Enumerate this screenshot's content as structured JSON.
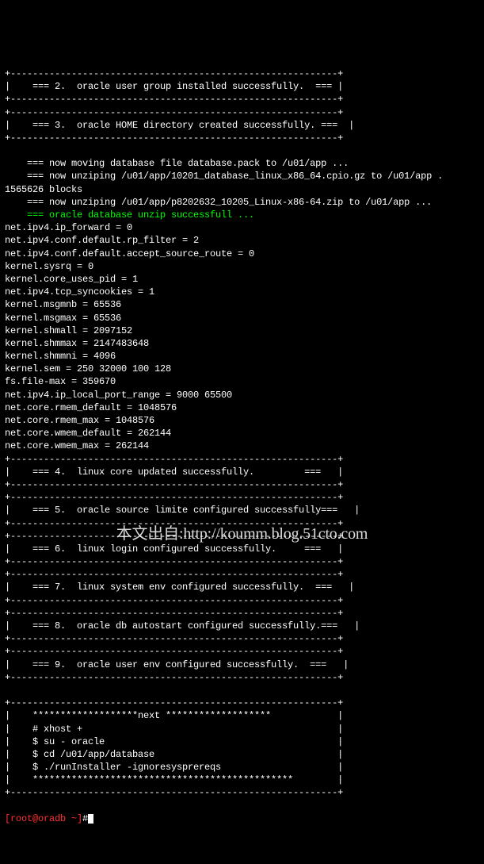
{
  "lines": [
    {
      "t": "+-----------------------------------------------------------+",
      "c": "term-line"
    },
    {
      "t": "|    === 2.  oracle user group installed successfully.  === |",
      "c": "term-line"
    },
    {
      "t": "+-----------------------------------------------------------+",
      "c": "term-line"
    },
    {
      "t": "+-----------------------------------------------------------+",
      "c": "term-line"
    },
    {
      "t": "|    === 3.  oracle HOME directory created successfully. ===  |",
      "c": "term-line"
    },
    {
      "t": "+-----------------------------------------------------------+",
      "c": "term-line"
    },
    {
      "t": "",
      "c": "term-line"
    },
    {
      "t": "    === now moving database file database.pack to /u01/app ...",
      "c": "term-line"
    },
    {
      "t": "    === now unziping /u01/app/10201_database_linux_x86_64.cpio.gz to /u01/app .",
      "c": "term-line"
    },
    {
      "t": "1565626 blocks",
      "c": "term-line"
    },
    {
      "t": "    === now unziping /u01/app/p8202632_10205_Linux-x86-64.zip to /u01/app ...",
      "c": "term-line"
    },
    {
      "t": "    === oracle database unzip successfull ...",
      "c": "green"
    },
    {
      "t": "net.ipv4.ip_forward = 0",
      "c": "term-line"
    },
    {
      "t": "net.ipv4.conf.default.rp_filter = 2",
      "c": "term-line"
    },
    {
      "t": "net.ipv4.conf.default.accept_source_route = 0",
      "c": "term-line"
    },
    {
      "t": "kernel.sysrq = 0",
      "c": "term-line"
    },
    {
      "t": "kernel.core_uses_pid = 1",
      "c": "term-line"
    },
    {
      "t": "net.ipv4.tcp_syncookies = 1",
      "c": "term-line"
    },
    {
      "t": "kernel.msgmnb = 65536",
      "c": "term-line"
    },
    {
      "t": "kernel.msgmax = 65536",
      "c": "term-line"
    },
    {
      "t": "kernel.shmall = 2097152",
      "c": "term-line"
    },
    {
      "t": "kernel.shmmax = 2147483648",
      "c": "term-line"
    },
    {
      "t": "kernel.shmmni = 4096",
      "c": "term-line"
    },
    {
      "t": "kernel.sem = 250 32000 100 128",
      "c": "term-line"
    },
    {
      "t": "fs.file-max = 359670",
      "c": "term-line"
    },
    {
      "t": "net.ipv4.ip_local_port_range = 9000 65500",
      "c": "term-line"
    },
    {
      "t": "net.core.rmem_default = 1048576",
      "c": "term-line"
    },
    {
      "t": "net.core.rmem_max = 1048576",
      "c": "term-line"
    },
    {
      "t": "net.core.wmem_default = 262144",
      "c": "term-line"
    },
    {
      "t": "net.core.wmem_max = 262144",
      "c": "term-line"
    },
    {
      "t": "+-----------------------------------------------------------+",
      "c": "term-line"
    },
    {
      "t": "|    === 4.  linux core updated successfully.         ===   |",
      "c": "term-line"
    },
    {
      "t": "+-----------------------------------------------------------+",
      "c": "term-line"
    },
    {
      "t": "+-----------------------------------------------------------+",
      "c": "term-line"
    },
    {
      "t": "|    === 5.  oracle source limite configured successfully===   |",
      "c": "term-line"
    },
    {
      "t": "+-----------------------------------------------------------+",
      "c": "term-line"
    },
    {
      "t": "+-----------------------------------------------------------+",
      "c": "term-line"
    },
    {
      "t": "|    === 6.  linux login configured successfully.     ===   |",
      "c": "term-line"
    },
    {
      "t": "+-----------------------------------------------------------+",
      "c": "term-line"
    },
    {
      "t": "+-----------------------------------------------------------+",
      "c": "term-line"
    },
    {
      "t": "|    === 7.  linux system env configured successfully.  ===   |",
      "c": "term-line"
    },
    {
      "t": "+-----------------------------------------------------------+",
      "c": "term-line"
    },
    {
      "t": "+-----------------------------------------------------------+",
      "c": "term-line"
    },
    {
      "t": "|    === 8.  oracle db autostart configured successfully.===   |",
      "c": "term-line"
    },
    {
      "t": "+-----------------------------------------------------------+",
      "c": "term-line"
    },
    {
      "t": "+-----------------------------------------------------------+",
      "c": "term-line"
    },
    {
      "t": "|    === 9.  oracle user env configured successfully.  ===   |",
      "c": "term-line"
    },
    {
      "t": "+-----------------------------------------------------------+",
      "c": "term-line"
    },
    {
      "t": "",
      "c": "term-line"
    },
    {
      "t": "+-----------------------------------------------------------+",
      "c": "term-line"
    },
    {
      "t": "|    *******************next *******************            |",
      "c": "term-line"
    },
    {
      "t": "|    # xhost +                                              |",
      "c": "term-line"
    },
    {
      "t": "|    $ su - oracle                                          |",
      "c": "term-line"
    },
    {
      "t": "|    $ cd /u01/app/database                                 |",
      "c": "term-line"
    },
    {
      "t": "|    $ ./runInstaller -ignoresysprereqs                     |",
      "c": "term-line"
    },
    {
      "t": "|    ***********************************************        |",
      "c": "term-line"
    },
    {
      "t": "+-----------------------------------------------------------+",
      "c": "term-line"
    }
  ],
  "prompt": {
    "user_host": "[root@oradb ~]",
    "symbol": "#"
  },
  "watermark": "本文出自:http://koumm.blog.51cto.com"
}
